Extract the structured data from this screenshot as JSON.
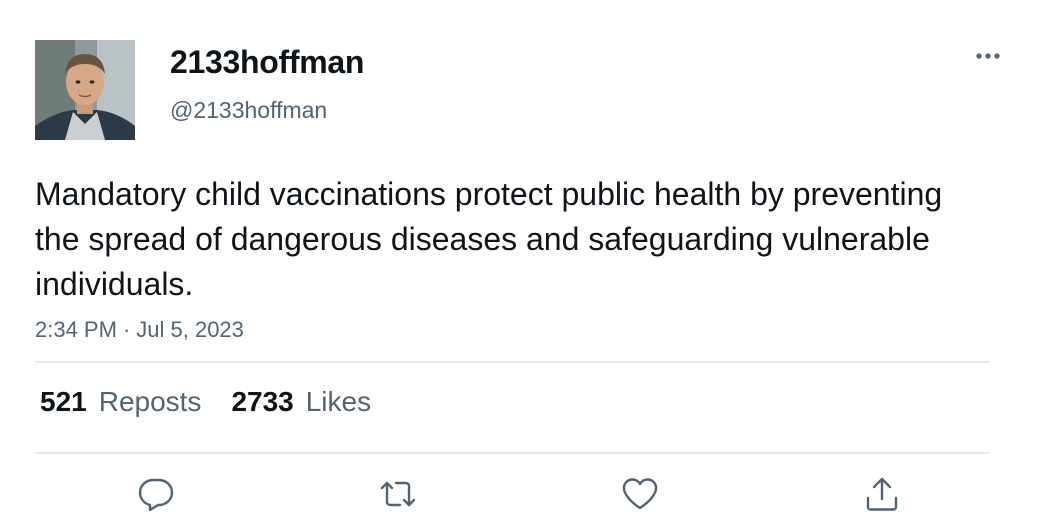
{
  "tweet": {
    "display_name": "2133hoffman",
    "handle": "@2133hoffman",
    "text": "Mandatory child vaccinations protect public health by preventing the spread of dangerous diseases and safeguarding vulnerable individuals.",
    "time": "2:34 PM",
    "separator": "·",
    "date": "Jul 5, 2023",
    "stats": {
      "reposts_count": "521",
      "reposts_label": "Reposts",
      "likes_count": "2733",
      "likes_label": "Likes"
    },
    "icons": {
      "more": "more-horizontal-icon",
      "reply": "reply-icon",
      "repost": "repost-icon",
      "like": "heart-icon",
      "share": "share-icon"
    },
    "colors": {
      "text": "#0f1419",
      "secondary": "#536471",
      "divider": "#e6e9ec",
      "icon": "#536471"
    }
  }
}
